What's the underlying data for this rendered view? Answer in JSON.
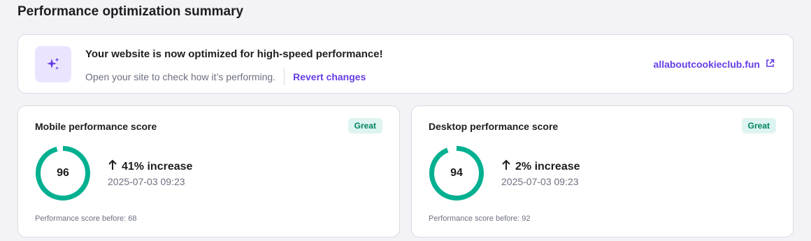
{
  "page": {
    "title": "Performance optimization summary"
  },
  "banner": {
    "icon": "sparkles-icon",
    "heading": "Your website is now optimized for high-speed performance!",
    "subtext": "Open your site to check how it’s performing.",
    "revert_label": "Revert changes",
    "site_link": "allaboutcookieclub.fun",
    "site_link_icon": "external-link-icon"
  },
  "colors": {
    "accent": "#673de6",
    "success": "#00b090",
    "badge_bg": "#def4f0",
    "badge_text": "#008361"
  },
  "cards": [
    {
      "title": "Mobile performance score",
      "badge": "Great",
      "score": "96",
      "score_value": 96,
      "change": "41% increase",
      "change_icon": "arrow-up-icon",
      "timestamp": "2025-07-03 09:23",
      "before": "Performance score before: 68"
    },
    {
      "title": "Desktop performance score",
      "badge": "Great",
      "score": "94",
      "score_value": 94,
      "change": "2% increase",
      "change_icon": "arrow-up-icon",
      "timestamp": "2025-07-03 09:23",
      "before": "Performance score before: 92"
    }
  ]
}
